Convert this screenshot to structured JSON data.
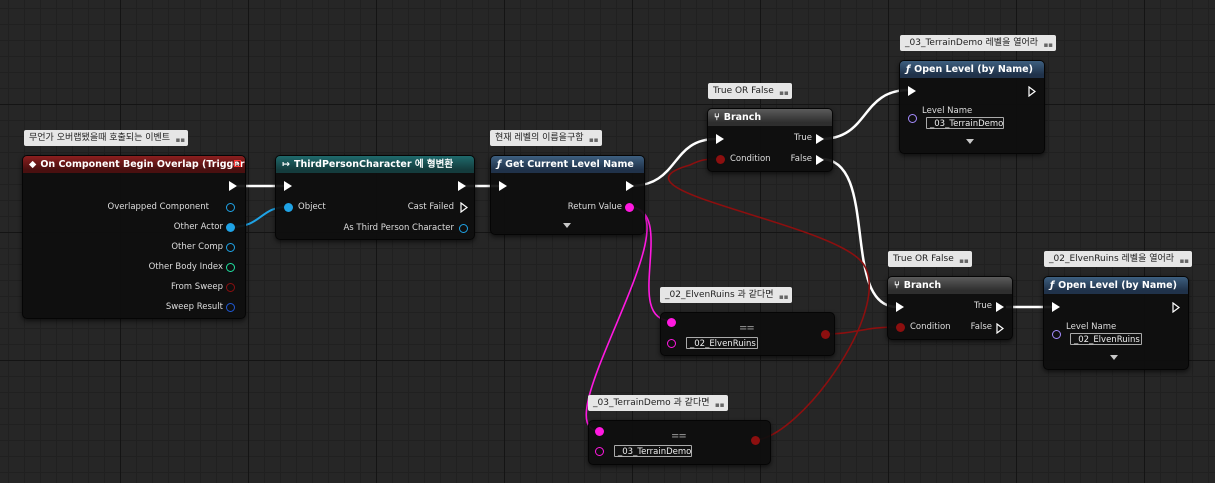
{
  "comments": {
    "event": "무언가 오버랩됐을때 호출되는 이벤트",
    "get_level": "현재 레벨의 이름을구함",
    "branch1": "True OR False",
    "branch2": "True OR False",
    "open_terrain": "_03_TerrainDemo 레벨을 열어라",
    "open_elven": "_02_ElvenRuins 레벨을 열어라",
    "equal_elven": "_02_ElvenRuins 과 같다면",
    "equal_terrain": "_03_TerrainDemo 과 같다면"
  },
  "event_node": {
    "title": "On Component Begin Overlap (Trigger)",
    "pins": [
      "Overlapped Component",
      "Other Actor",
      "Other Comp",
      "Other Body Index",
      "From Sweep",
      "Sweep Result"
    ]
  },
  "cast_node": {
    "title": "ThirdPersonCharacter 에 형변환",
    "object": "Object",
    "cast_failed": "Cast Failed",
    "as_char": "As Third Person Character"
  },
  "get_level_node": {
    "title": "Get Current Level Name",
    "return_value": "Return Value"
  },
  "branch1": {
    "title": "Branch",
    "condition": "Condition",
    "true": "True",
    "false": "False"
  },
  "branch2": {
    "title": "Branch",
    "condition": "Condition",
    "true": "True",
    "false": "False"
  },
  "open_level1": {
    "title": "Open Level (by Name)",
    "param": "Level Name",
    "value": "_03_TerrainDemo"
  },
  "open_level2": {
    "title": "Open Level (by Name)",
    "param": "Level Name",
    "value": "_02_ElvenRuins"
  },
  "equal1": {
    "value": "_02_ElvenRuins",
    "op": "=="
  },
  "equal2": {
    "value": "_03_TerrainDemo",
    "op": "=="
  },
  "colors": {
    "exec": "#ffffff",
    "object": "#1fa3e6",
    "string": "#ff19e0",
    "bool": "#8c0f0f",
    "struct": "#1f5ad6",
    "int": "#1fe0a0",
    "name": "#a58cff"
  }
}
